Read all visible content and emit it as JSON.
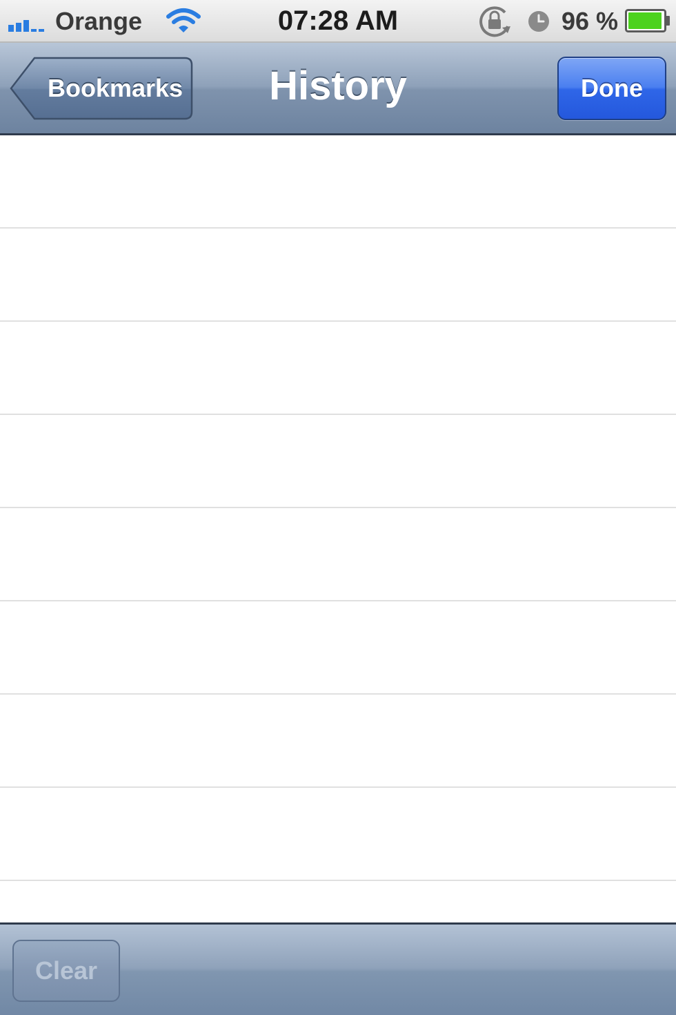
{
  "status_bar": {
    "carrier": "Orange",
    "time": "07:28 AM",
    "battery_percent": "96 %",
    "icons": [
      "signal-bars-icon",
      "wifi-icon",
      "rotation-lock-icon",
      "alarm-clock-icon",
      "battery-icon"
    ],
    "battery_level": 0.96
  },
  "nav_bar": {
    "title": "History",
    "back_label": "Bookmarks",
    "done_label": "Done"
  },
  "history_list": {
    "rows": [
      "",
      "",
      "",
      "",
      "",
      "",
      "",
      "",
      ""
    ]
  },
  "toolbar": {
    "clear_label": "Clear",
    "clear_enabled": false
  },
  "colors": {
    "nav_bar": "#8ea1b9",
    "done_button": "#2f66e8",
    "row_separator": "#e0e0e0",
    "battery_fill": "#4cd21e"
  }
}
